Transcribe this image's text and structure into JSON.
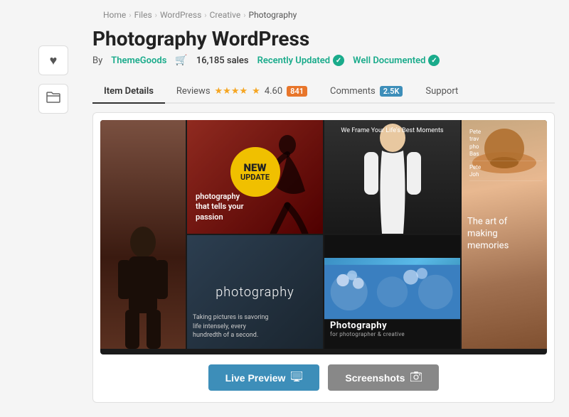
{
  "breadcrumb": {
    "items": [
      "Home",
      "Files",
      "WordPress",
      "Creative",
      "Photography"
    ]
  },
  "page": {
    "title": "Photography WordPress",
    "author_label": "By",
    "author_name": "ThemeGoods",
    "cart_icon": "🛒",
    "sales": "16,185 sales",
    "badge_recently": "Recently Updated",
    "badge_documented": "Well Documented"
  },
  "tabs": {
    "items": [
      {
        "label": "Item Details",
        "active": true
      },
      {
        "label": "Reviews",
        "active": false
      },
      {
        "label": "Comments",
        "active": false
      },
      {
        "label": "Support",
        "active": false
      }
    ],
    "rating_stars": "★★★★",
    "rating_half": "½",
    "rating_num": "4.60",
    "reviews_count": "841",
    "comments_count": "2.5K"
  },
  "preview_image": {
    "new_badge_line1": "NEW",
    "new_badge_line2": "UPDATE",
    "cell2_text": "photography\nthat tells your\npassion",
    "cell3_text": "We Frame Your Life's Best Moments",
    "art_text": "The art of\nmaking\nmemories",
    "cell5_text": "photography",
    "cell5_bottom": "Taking pictures is savoring\nlife intensely, every\nhundredth of a second.",
    "cell6_main": "Photography",
    "cell6_sub": "for photographer & creative",
    "mini_items": [
      "Pete\ntrav\npho\nBas",
      "Pete\nJoh"
    ]
  },
  "buttons": {
    "live_preview": "Live Preview",
    "screenshots": "Screenshots"
  },
  "sidebar": {
    "heart_icon": "♥",
    "folder_icon": "📂"
  }
}
